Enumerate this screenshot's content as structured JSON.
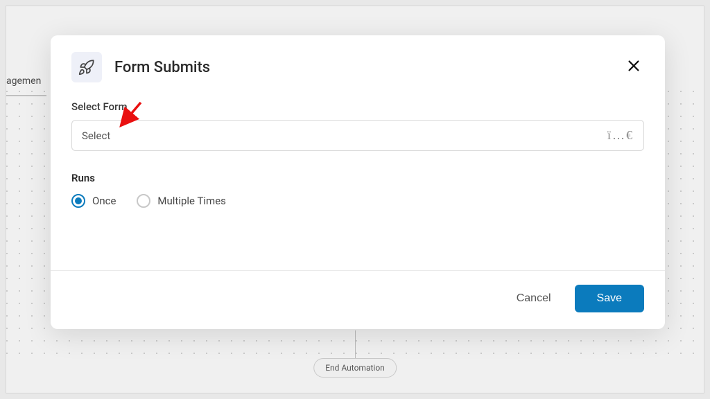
{
  "background": {
    "tab_fragment": "agemen",
    "end_automation_label": "End Automation"
  },
  "modal": {
    "title": "Form Submits",
    "select_form_label": "Select Form",
    "select_placeholder": "Select",
    "select_suffix": "ï…€",
    "runs_label": "Runs",
    "runs_options": {
      "once": "Once",
      "multiple": "Multiple Times"
    },
    "runs_selected": "once",
    "cancel_label": "Cancel",
    "save_label": "Save"
  }
}
